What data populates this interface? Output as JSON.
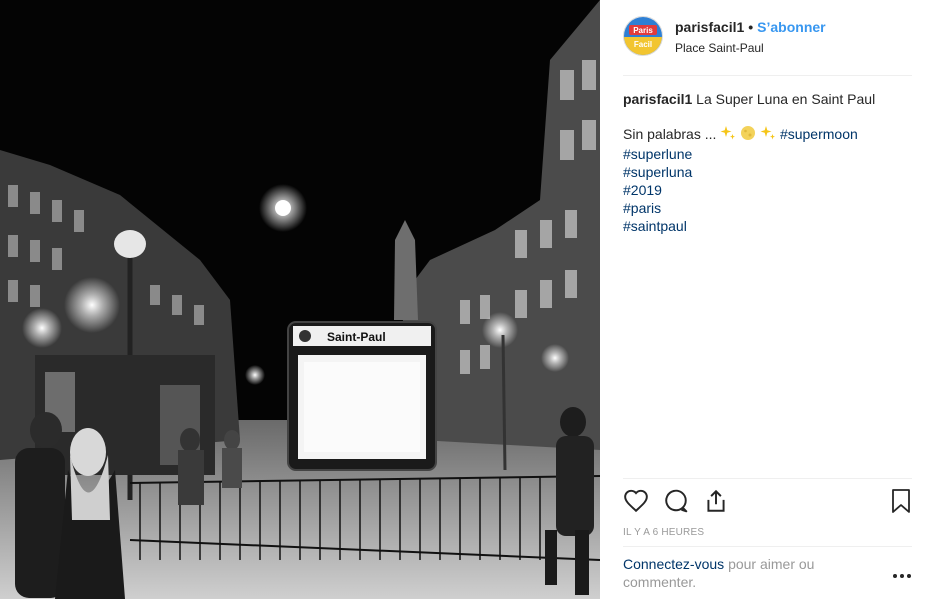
{
  "post": {
    "photo": {
      "sign_text": "Saint-Paul"
    },
    "header": {
      "username": "parisfacil1",
      "separator": "•",
      "follow_label": "S’abonner",
      "location": "Place Saint-Paul",
      "avatar_text_top": "Paris",
      "avatar_text_bottom": "Facil"
    },
    "caption": {
      "username": "parisfacil1",
      "title": "La Super Luna en Saint Paul",
      "line1_text": "Sin palabras ...",
      "line1_hashtag": "#supermoon",
      "hashtags": [
        "#superlune",
        "#superluna",
        "#2019",
        "#paris",
        "#saintpaul"
      ]
    },
    "actions": {
      "like_icon": "heart-icon",
      "comment_icon": "comment-icon",
      "share_icon": "share-icon",
      "save_icon": "bookmark-icon"
    },
    "timestamp": "IL Y A 6 HEURES",
    "login_prompt": {
      "link": "Connectez-vous",
      "rest": "pour aimer ou commenter."
    },
    "more_icon": "more-options-icon"
  }
}
